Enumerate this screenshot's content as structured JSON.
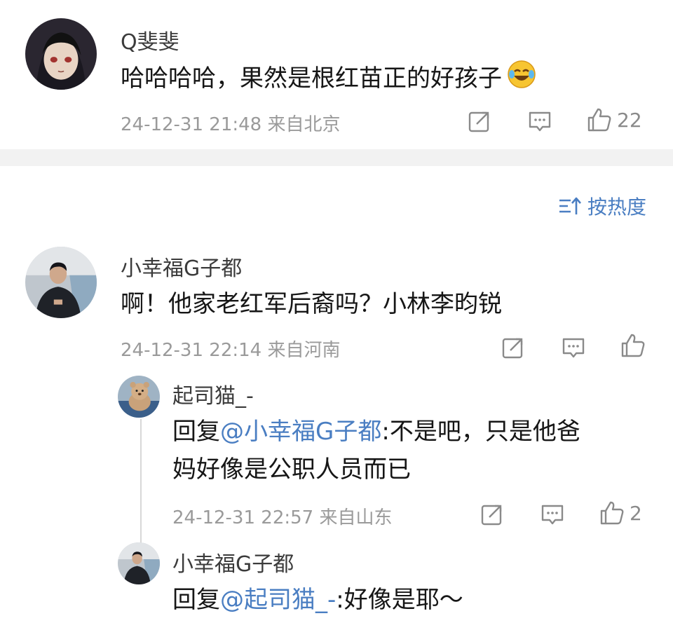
{
  "comments": [
    {
      "username": "Q斐斐",
      "text": "哈哈哈哈，果然是根红苗正的好孩子",
      "emoji": "😂",
      "meta": "24-12-31 21:48  来自北京",
      "likes": "22"
    },
    {
      "username": "小幸福G子都",
      "text": "啊！他家老红军后裔吗？小林李昀锐",
      "meta": "24-12-31 22:14  来自河南",
      "likes": ""
    }
  ],
  "sort": {
    "label": "按热度"
  },
  "replies": [
    {
      "username": "起司猫_-",
      "prefix": "回复",
      "mention": "@小幸福G子都",
      "text_line1": ":不是吧，只是他爸",
      "text_line2": "妈好像是公职人员而已",
      "meta": "24-12-31 22:57  来自山东",
      "likes": "2"
    },
    {
      "username": "小幸福G子都",
      "prefix": "回复",
      "mention": "@起司猫_-",
      "text_line1": ":好像是耶～"
    }
  ],
  "colors": {
    "accent": "#4a7ec2",
    "meta_text": "#9a9a9a",
    "divider": "#f2f2f2"
  }
}
